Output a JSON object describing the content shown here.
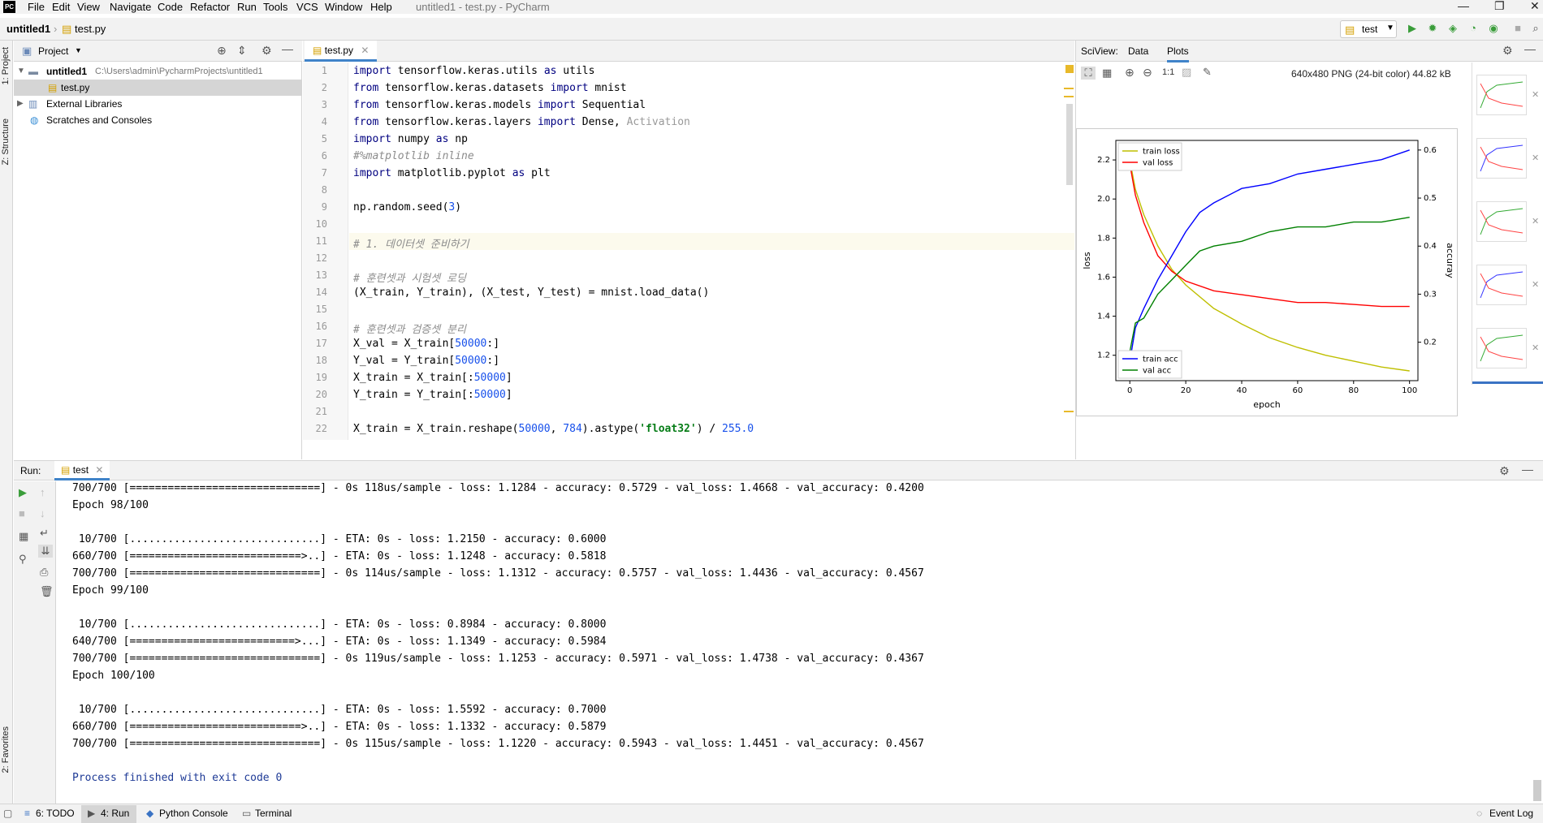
{
  "app": {
    "title": "untitled1 - test.py - PyCharm",
    "logo": "PC"
  },
  "menu": [
    "File",
    "Edit",
    "View",
    "Navigate",
    "Code",
    "Refactor",
    "Run",
    "Tools",
    "VCS",
    "Window",
    "Help"
  ],
  "breadcrumb": {
    "project": "untitled1",
    "file": "test.py"
  },
  "run_config": "test",
  "project_panel": {
    "title": "Project",
    "root": "untitled1",
    "root_path": "C:\\Users\\admin\\PycharmProjects\\untitled1",
    "file": "test.py",
    "external": "External Libraries",
    "scratches": "Scratches and Consoles"
  },
  "side_tabs": {
    "project": "1: Project",
    "structure": "Z: Structure",
    "favorites": "2: Favorites"
  },
  "editor": {
    "tab": "test.py",
    "lines": [
      {
        "n": "1",
        "html": "<span class='kw'>import</span> tensorflow.keras.utils <span class='kw'>as</span> utils"
      },
      {
        "n": "2",
        "html": "<span class='kw'>from</span> tensorflow.keras.datasets <span class='kw'>import</span> mnist"
      },
      {
        "n": "3",
        "html": "<span class='kw'>from</span> tensorflow.keras.models <span class='kw'>import</span> Sequential"
      },
      {
        "n": "4",
        "html": "<span class='kw'>from</span> tensorflow.keras.layers <span class='kw'>import</span> Dense, <span class='gray'>Activation</span>"
      },
      {
        "n": "5",
        "html": "<span class='kw'>import</span> numpy <span class='kw'>as</span> np"
      },
      {
        "n": "6",
        "html": "<span class='cmt'>#%matplotlib inline</span>"
      },
      {
        "n": "7",
        "html": "<span class='kw'>import</span> matplotlib.pyplot <span class='kw'>as</span> plt"
      },
      {
        "n": "8",
        "html": ""
      },
      {
        "n": "9",
        "html": "np.random.seed(<span class='num'>3</span>)"
      },
      {
        "n": "10",
        "html": ""
      },
      {
        "n": "11",
        "html": "<span class='cmt'># 1. 데이터셋 준비하기</span>"
      },
      {
        "n": "12",
        "html": ""
      },
      {
        "n": "13",
        "html": "<span class='cmt'># 훈련셋과 시험셋 로딩</span>"
      },
      {
        "n": "14",
        "html": "(X_train, Y_train), (X_test, Y_test) = mnist.load_data()"
      },
      {
        "n": "15",
        "html": ""
      },
      {
        "n": "16",
        "html": "<span class='cmt'># 훈련셋과 검증셋 분리</span>"
      },
      {
        "n": "17",
        "html": "X_val = X_train[<span class='num'>50000</span>:]"
      },
      {
        "n": "18",
        "html": "Y_val = Y_train[<span class='num'>50000</span>:]"
      },
      {
        "n": "19",
        "html": "X_train = X_train[:<span class='num'>50000</span>]"
      },
      {
        "n": "20",
        "html": "Y_train = Y_train[:<span class='num'>50000</span>]"
      },
      {
        "n": "21",
        "html": ""
      },
      {
        "n": "22",
        "html": "X_train = X_train.reshape(<span class='num'>50000</span>, <span class='num'>784</span>).astype(<span class='str'>'float32'</span>) / <span class='num'>255.0</span>"
      }
    ]
  },
  "sciview": {
    "label": "SciView:",
    "tabs": [
      "Data",
      "Plots"
    ],
    "info": "640x480 PNG (24-bit color) 44.82 kB",
    "one_to_one": "1:1"
  },
  "run": {
    "label": "Run:",
    "tab": "test"
  },
  "console": [
    {
      "t": "700/700 [==============================] - 0s 118us/sample - loss: 1.1284 - accuracy: 0.5729 - val_loss: 1.4668 - val_accuracy: 0.4200"
    },
    {
      "t": "Epoch 98/100"
    },
    {
      "t": ""
    },
    {
      "t": " 10/700 [..............................] - ETA: 0s - loss: 1.2150 - accuracy: 0.6000"
    },
    {
      "t": "660/700 [===========================>..] - ETA: 0s - loss: 1.1248 - accuracy: 0.5818"
    },
    {
      "t": "700/700 [==============================] - 0s 114us/sample - loss: 1.1312 - accuracy: 0.5757 - val_loss: 1.4436 - val_accuracy: 0.4567"
    },
    {
      "t": "Epoch 99/100"
    },
    {
      "t": ""
    },
    {
      "t": " 10/700 [..............................] - ETA: 0s - loss: 0.8984 - accuracy: 0.8000"
    },
    {
      "t": "640/700 [==========================>...] - ETA: 0s - loss: 1.1349 - accuracy: 0.5984"
    },
    {
      "t": "700/700 [==============================] - 0s 119us/sample - loss: 1.1253 - accuracy: 0.5971 - val_loss: 1.4738 - val_accuracy: 0.4367"
    },
    {
      "t": "Epoch 100/100"
    },
    {
      "t": ""
    },
    {
      "t": " 10/700 [..............................] - ETA: 0s - loss: 1.5592 - accuracy: 0.7000"
    },
    {
      "t": "660/700 [===========================>..] - ETA: 0s - loss: 1.1332 - accuracy: 0.5879"
    },
    {
      "t": "700/700 [==============================] - 0s 115us/sample - loss: 1.1220 - accuracy: 0.5943 - val_loss: 1.4451 - val_accuracy: 0.4567"
    },
    {
      "t": ""
    },
    {
      "t": "Process finished with exit code 0",
      "blue": true
    }
  ],
  "statusbar": {
    "todo": "6: TODO",
    "run": "4: Run",
    "python_console": "Python Console",
    "terminal": "Terminal",
    "event_log": "Event Log"
  },
  "chart_data": {
    "type": "line",
    "title": "",
    "xlabel": "epoch",
    "ylabel": "loss",
    "y2label": "accuray",
    "xlim": [
      -5,
      103
    ],
    "ylim": [
      1.07,
      2.3
    ],
    "y2lim": [
      0.12,
      0.62
    ],
    "xticks": [
      "0",
      "20",
      "40",
      "60",
      "80",
      "100"
    ],
    "yticks": [
      "1.2",
      "1.4",
      "1.6",
      "1.8",
      "2.0",
      "2.2"
    ],
    "y2ticks": [
      "0.2",
      "0.3",
      "0.4",
      "0.5",
      "0.6"
    ],
    "series": [
      {
        "name": "train loss",
        "axis": "left",
        "color": "#bfbf00",
        "x": [
          0,
          2,
          5,
          10,
          15,
          20,
          30,
          40,
          50,
          60,
          70,
          80,
          90,
          100
        ],
        "y": [
          2.2,
          2.05,
          1.92,
          1.76,
          1.64,
          1.56,
          1.44,
          1.36,
          1.29,
          1.24,
          1.2,
          1.17,
          1.14,
          1.12
        ]
      },
      {
        "name": "val loss",
        "axis": "left",
        "color": "#ff0000",
        "x": [
          0,
          2,
          5,
          10,
          15,
          20,
          30,
          40,
          50,
          60,
          70,
          80,
          90,
          100
        ],
        "y": [
          2.18,
          2.02,
          1.88,
          1.71,
          1.63,
          1.58,
          1.53,
          1.51,
          1.49,
          1.47,
          1.47,
          1.46,
          1.45,
          1.45
        ]
      },
      {
        "name": "train acc",
        "axis": "right",
        "color": "#0000ff",
        "x": [
          0,
          2,
          5,
          10,
          15,
          20,
          25,
          30,
          40,
          50,
          60,
          70,
          80,
          90,
          100
        ],
        "y": [
          0.16,
          0.23,
          0.27,
          0.33,
          0.38,
          0.43,
          0.47,
          0.49,
          0.52,
          0.53,
          0.55,
          0.56,
          0.57,
          0.58,
          0.6
        ]
      },
      {
        "name": "val acc",
        "axis": "right",
        "color": "#008000",
        "x": [
          0,
          2,
          5,
          10,
          15,
          20,
          25,
          30,
          40,
          50,
          60,
          70,
          80,
          90,
          100
        ],
        "y": [
          0.18,
          0.24,
          0.25,
          0.3,
          0.33,
          0.36,
          0.39,
          0.4,
          0.41,
          0.43,
          0.44,
          0.44,
          0.45,
          0.45,
          0.46
        ]
      }
    ],
    "legends": [
      "top-left",
      "bottom-left"
    ]
  }
}
